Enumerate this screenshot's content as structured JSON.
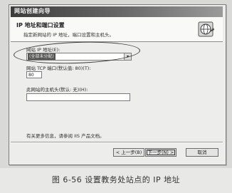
{
  "window": {
    "title": "网站创建向导"
  },
  "header": {
    "title": "IP 地址和端口设置",
    "subtitle": "指定新网站的 IP 地址，端口设置和主机头。"
  },
  "ip": {
    "label": "网站 IP 地址(E):",
    "value": "(全部未分配)",
    "arrow": "▾"
  },
  "port": {
    "label": "网站 TCP 端口(默认值: 80)(T):",
    "value": "80"
  },
  "host": {
    "label": "此网站的主机头(默认: 无)(H):",
    "value": ""
  },
  "note": "有关更多信息，请参阅 IIS 产品文档。",
  "buttons": {
    "back": "< 上一步(B)",
    "next": "下一步(N) >",
    "cancel": "取消"
  },
  "caption": "图 6-56   设置教务处站点的 IP 地址"
}
